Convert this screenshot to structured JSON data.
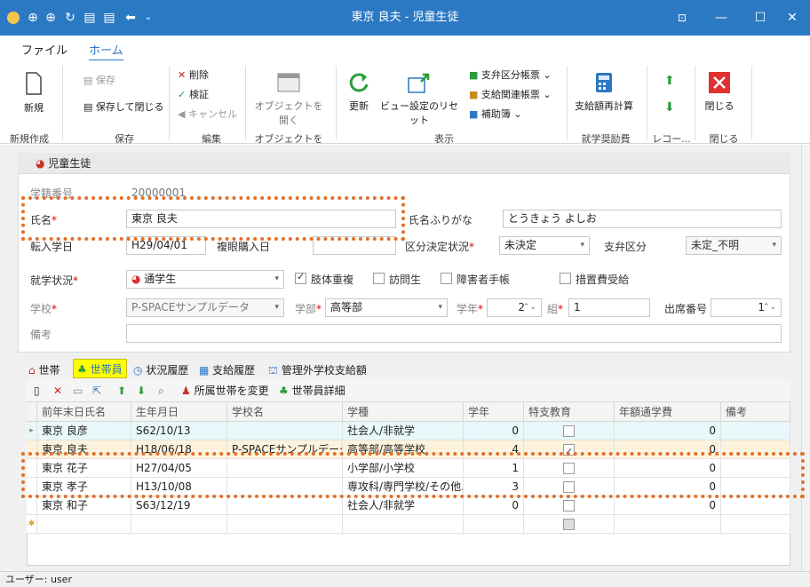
{
  "window": {
    "title": "東京 良夫 - 児童生徒",
    "min": "—",
    "max": "☐",
    "close": "✕",
    "icon_button": "⊡"
  },
  "menu": {
    "file": "ファイル",
    "home": "ホーム"
  },
  "ribbon": {
    "new": "新規",
    "save": "保存",
    "save_close": "保存して閉じる",
    "delete": "削除",
    "verify": "検証",
    "cancel": "キャンセル",
    "open_object": "オブジェクトを開く",
    "refresh": "更新",
    "view_reset": "ビュー設定のリセット",
    "report1": "支弁区分帳票",
    "report2": "支給関連帳票",
    "aux": "補助簿",
    "recalc": "支給額再計算",
    "close": "閉じる",
    "groups": {
      "new": "新規作成",
      "save": "保存",
      "edit": "編集",
      "open": "オブジェクトを開く",
      "view": "表示",
      "aid": "就学奨励費",
      "record": "レコー...",
      "close": "閉じる"
    }
  },
  "section": {
    "title": "児童生徒"
  },
  "form": {
    "student_no_label": "学籍番号",
    "student_no": "20000001",
    "name_label": "氏名",
    "name": "東京 良夫",
    "kana_label": "氏名ふりがな",
    "kana": "とうきょう よしお",
    "transfer_label": "転入学日",
    "transfer": "H29/04/01",
    "purchase_label": "複眼購入日",
    "category_label": "区分決定状況",
    "category": "未決定",
    "subsidy_label": "支弁区分",
    "subsidy": "未定_不明",
    "status_label": "就学状況",
    "status": "通学生",
    "cb1": "肢体重複",
    "cb2": "訪問生",
    "cb3": "障害者手帳",
    "cb4": "措置費受給",
    "school_label": "学校",
    "school": "P-SPACEサンプルデータ",
    "dept_label": "学部",
    "dept": "高等部",
    "year_label": "学年",
    "year": "2",
    "class_label": "組",
    "class": "1",
    "seat_label": "出席番号",
    "seat": "1",
    "note_label": "備考"
  },
  "tabs": [
    "世帯",
    "世帯員",
    "状況履歴",
    "支給履歴",
    "管理外学校支給額"
  ],
  "grid_toolbar": {
    "change_household": "所属世帯を変更",
    "member_detail": "世帯員詳細"
  },
  "grid": {
    "columns": [
      "前年末日氏名",
      "生年月日",
      "学校名",
      "学種",
      "学年",
      "特支教育",
      "年額通学費",
      "備考"
    ],
    "rows": [
      {
        "name": "東京 良彦",
        "dob": "S62/10/13",
        "school": "",
        "type": "社会人/非就学",
        "grade": "0",
        "special": false,
        "fee": "0"
      },
      {
        "name": "東京 良夫",
        "dob": "H18/06/18",
        "school": "P-SPACEサンプルデータ",
        "type": "高等部/高等学校",
        "grade": "4",
        "special": true,
        "fee": "0"
      },
      {
        "name": "東京 花子",
        "dob": "H27/04/05",
        "school": "",
        "type": "小学部/小学校",
        "grade": "1",
        "special": false,
        "fee": "0"
      },
      {
        "name": "東京 孝子",
        "dob": "H13/10/08",
        "school": "",
        "type": "専攻科/専門学校/その他...",
        "grade": "3",
        "special": false,
        "fee": "0"
      },
      {
        "name": "東京 和子",
        "dob": "S63/12/19",
        "school": "",
        "type": "社会人/非就学",
        "grade": "0",
        "special": false,
        "fee": "0"
      }
    ]
  },
  "status_bar": "ユーザー: user",
  "colors": {
    "title": "#2b79c2",
    "highlight": "#ffff00",
    "dash": "#e0702a",
    "red_btn": "#e03030",
    "green": "#2a9d3a"
  }
}
